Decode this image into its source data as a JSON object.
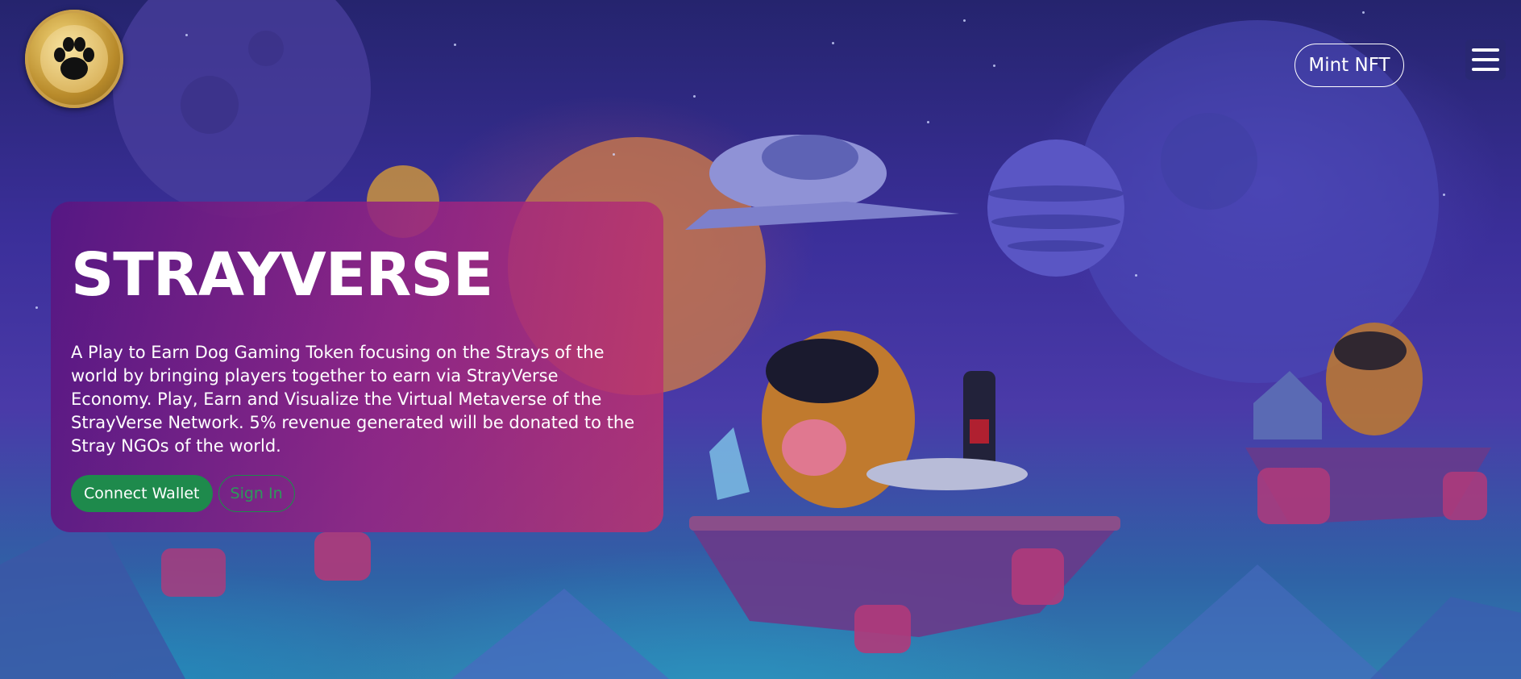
{
  "header": {
    "logo_icon": "paw-coin-logo",
    "mint_label": "Mint NFT",
    "menu_icon": "hamburger-menu-icon"
  },
  "hero": {
    "title": "STRAYVERSE",
    "description": "A Play to Earn Dog Gaming Token focusing on the Strays of the world by bringing players together to earn via StrayVerse Economy. Play, Earn and Visualize the Virtual Metaverse of the StrayVerse Network. 5% revenue generated will be donated to the Stray NGOs of the world.",
    "connect_label": "Connect Wallet",
    "signin_label": "Sign In"
  },
  "colors": {
    "accent_green": "#1e8a4c",
    "card_start": "#581682",
    "card_end": "#be326e",
    "sky": "#3b2f9a"
  }
}
